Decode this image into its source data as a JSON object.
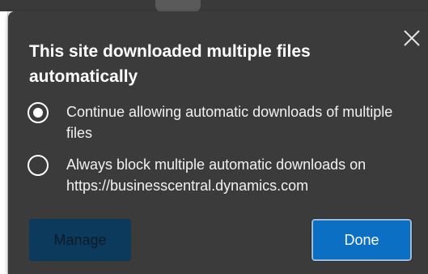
{
  "dialog": {
    "title": "This site downloaded multiple files automatically",
    "options": [
      {
        "label": "Continue allowing automatic downloads of multiple files",
        "selected": true
      },
      {
        "label": "Always block multiple automatic downloads on https://businesscentral.dynamics.com",
        "selected": false
      }
    ],
    "manage_label": "Manage",
    "done_label": "Done",
    "close_icon": "close-icon"
  },
  "colors": {
    "dialog_background": "#3b3b3b",
    "primary_button": "#0b6fc4",
    "manage_button": "#0b3a5c",
    "text": "#ffffff"
  }
}
